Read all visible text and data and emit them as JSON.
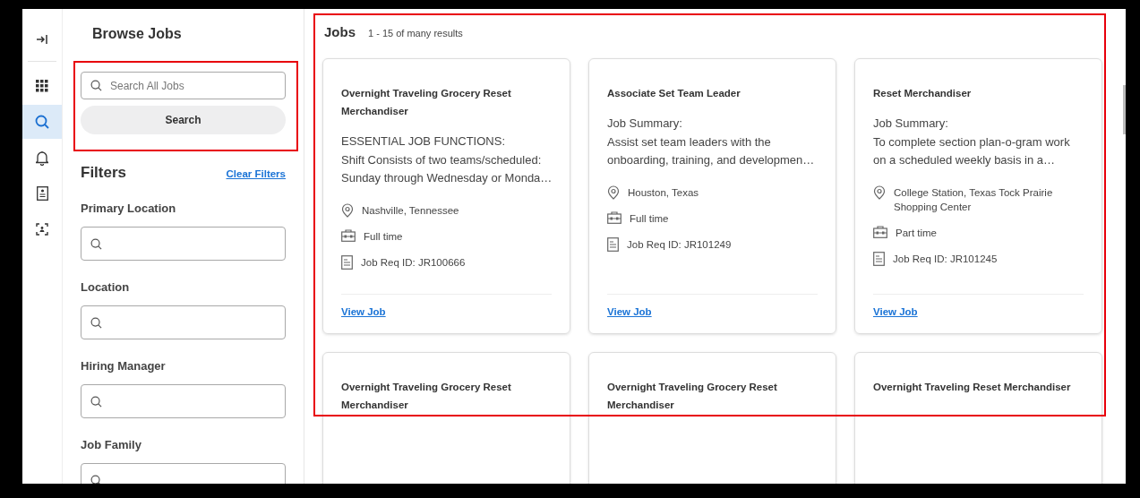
{
  "sidebar": {
    "items": [
      {
        "kind": "collapse",
        "selected": false
      },
      {
        "kind": "apps",
        "selected": false
      },
      {
        "kind": "search",
        "selected": true
      },
      {
        "kind": "bell",
        "selected": false
      },
      {
        "kind": "badge",
        "selected": false
      },
      {
        "kind": "scan",
        "selected": false
      }
    ]
  },
  "page_title": "Browse Jobs",
  "search": {
    "placeholder": "Search All Jobs",
    "button": "Search"
  },
  "filters": {
    "title": "Filters",
    "clear_link": "Clear Filters",
    "fields": [
      {
        "label": "Primary Location"
      },
      {
        "label": "Location"
      },
      {
        "label": "Hiring Manager"
      },
      {
        "label": "Job Family"
      }
    ]
  },
  "jobs": {
    "title": "Jobs",
    "count": "1 - 15 of many results",
    "cards": [
      {
        "title": "Overnight Traveling Grocery Reset Merchandiser",
        "description": [
          "ESSENTIAL JOB FUNCTIONS:",
          "Shift Consists of two teams/scheduled:",
          "Sunday through Wednesday or Monda…"
        ],
        "location": "Nashville, Tennessee",
        "time_type": "Full time",
        "req_id": "Job Req ID: JR100666",
        "link": "View Job"
      },
      {
        "title": "Associate Set Team Leader",
        "description": [
          "Job Summary:",
          "Assist set team leaders with the",
          "onboarding, training, and developmen…"
        ],
        "location": "Houston, Texas",
        "time_type": "Full time",
        "req_id": "Job Req ID: JR101249",
        "link": "View Job"
      },
      {
        "title": "Reset Merchandiser",
        "description": [
          "Job Summary:",
          "To complete section plan-o-gram work",
          "on a scheduled weekly basis in a…"
        ],
        "location": "College Station, Texas Tock Prairie Shopping Center",
        "time_type": "Part time",
        "req_id": "Job Req ID: JR101245",
        "link": "View Job"
      },
      {
        "title": "Overnight Traveling Grocery Reset Merchandiser"
      },
      {
        "title": "Overnight Traveling Grocery Reset Merchandiser"
      },
      {
        "title": "Overnight Traveling Reset Merchandiser"
      }
    ]
  }
}
